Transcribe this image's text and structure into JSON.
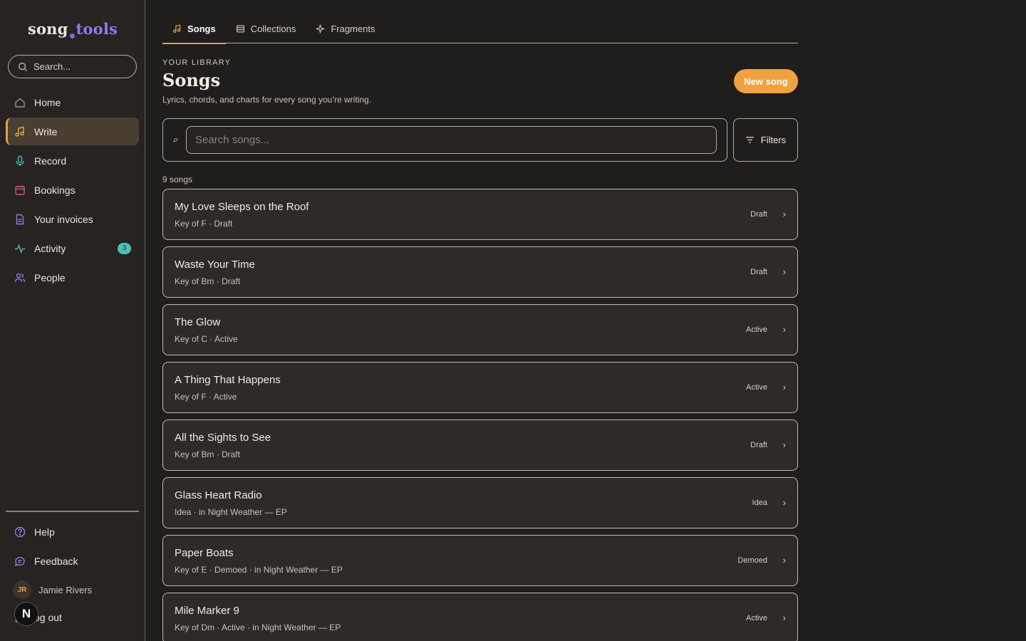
{
  "logo": {
    "part1": "song",
    "part2": "tools"
  },
  "sidebar": {
    "search_placeholder": "Search...",
    "items": [
      {
        "label": "Home",
        "icon": "home-icon"
      },
      {
        "label": "Write",
        "icon": "music-note-icon",
        "active": true
      },
      {
        "label": "Record",
        "icon": "microphone-icon"
      },
      {
        "label": "Bookings",
        "icon": "calendar-icon"
      },
      {
        "label": "Your invoices",
        "icon": "invoice-icon"
      },
      {
        "label": "Activity",
        "icon": "activity-icon",
        "badge": "3"
      },
      {
        "label": "People",
        "icon": "people-icon"
      }
    ],
    "bottom": {
      "help": "Help",
      "feedback": "Feedback",
      "user_initials": "JR",
      "user_name": "Jamie Rivers",
      "logout": "og out",
      "n_badge": "N"
    }
  },
  "colors": {
    "accent": "#f0a240",
    "brand_purple": "#8c7cf0",
    "badge_teal": "#4fc0b4"
  },
  "tabs": [
    {
      "label": "Songs",
      "icon": "music-note-icon",
      "active": true
    },
    {
      "label": "Collections",
      "icon": "collection-icon"
    },
    {
      "label": "Fragments",
      "icon": "sparkle-icon"
    }
  ],
  "header": {
    "eyebrow": "YOUR LIBRARY",
    "title": "Songs",
    "subtitle": "Lyrics, chords, and charts for every song you’re writing.",
    "new_button": "New song"
  },
  "search": {
    "glyph": "⌕",
    "placeholder": "Search songs...",
    "filters_label": "Filters"
  },
  "count_label": "9 songs",
  "songs": [
    {
      "title": "My Love Sleeps on the Roof",
      "meta": "Key of F · Draft",
      "status": "Draft"
    },
    {
      "title": "Waste Your Time",
      "meta": "Key of Bm · Draft",
      "status": "Draft"
    },
    {
      "title": "The Glow",
      "meta": "Key of C · Active",
      "status": "Active"
    },
    {
      "title": "A Thing That Happens",
      "meta": "Key of F · Active",
      "status": "Active"
    },
    {
      "title": "All the Sights to See",
      "meta": "Key of Bm · Draft",
      "status": "Draft"
    },
    {
      "title": "Glass Heart Radio",
      "meta": "Idea · in Night Weather — EP",
      "status": "Idea"
    },
    {
      "title": "Paper Boats",
      "meta": "Key of E · Demoed · in Night Weather — EP",
      "status": "Demoed"
    },
    {
      "title": "Mile Marker 9",
      "meta": "Key of Dm · Active · in Night Weather — EP",
      "status": "Active"
    }
  ]
}
